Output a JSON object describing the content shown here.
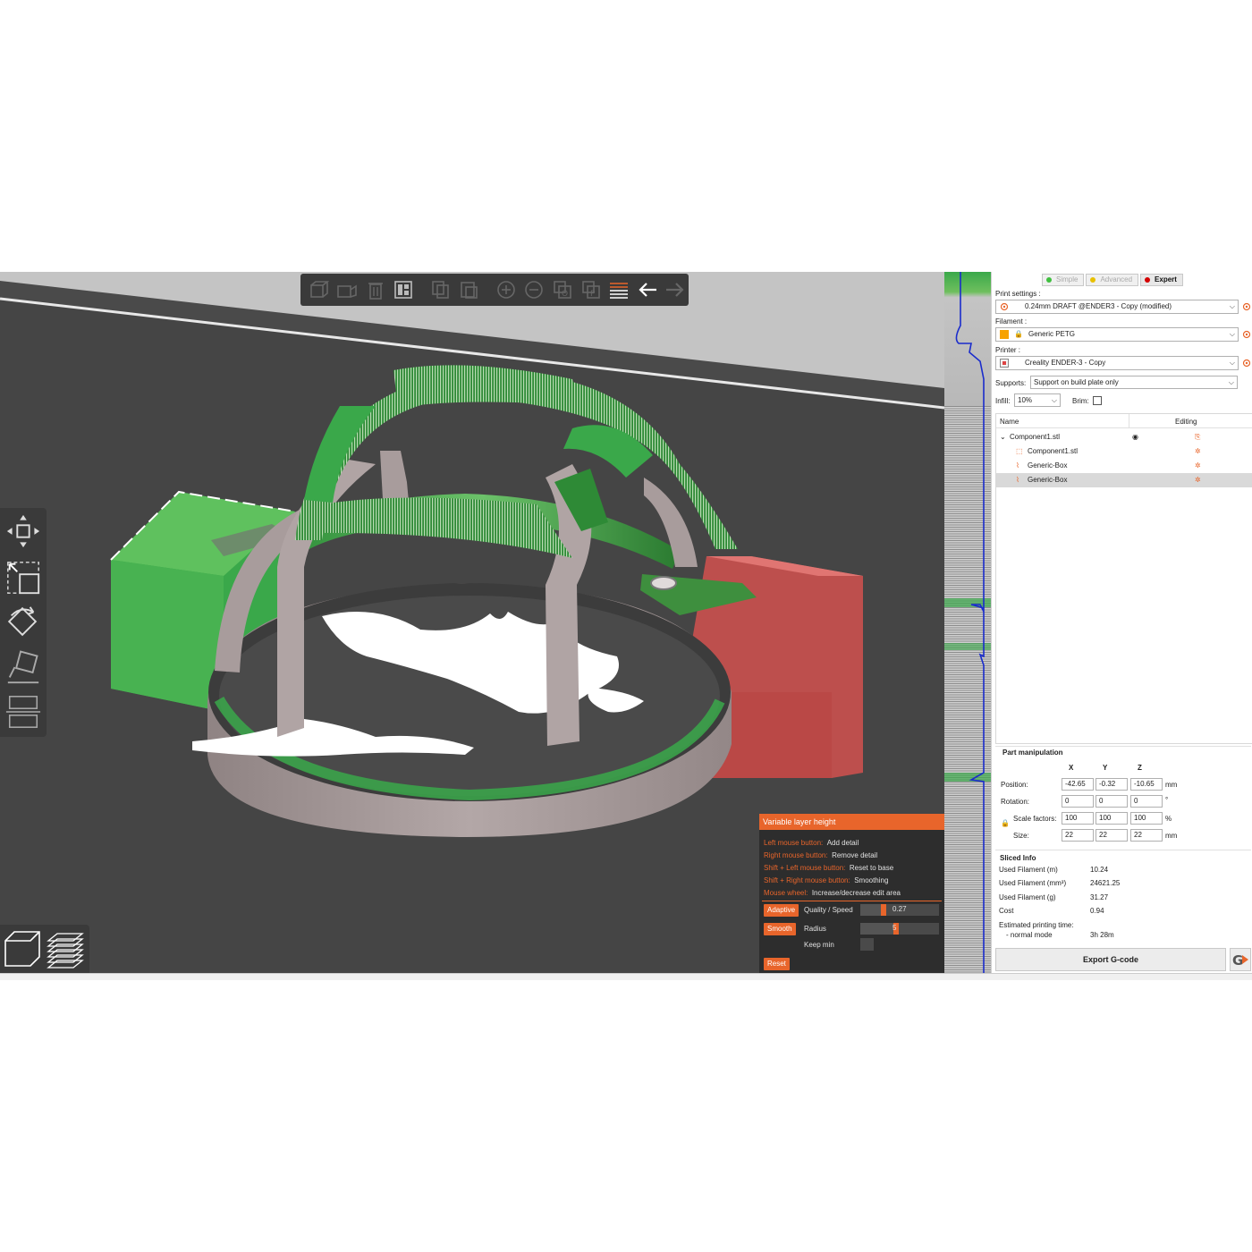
{
  "toolbar": {
    "icons": [
      "add-icon",
      "delete-icon",
      "delete-all-icon",
      "arrange-icon",
      "copy-icon",
      "paste-icon",
      "plus-icon",
      "minus-icon",
      "split-objects-icon",
      "split-parts-icon",
      "layers-editing-icon",
      "undo-icon",
      "redo-icon"
    ]
  },
  "left_tools": [
    "move-icon",
    "scale-icon",
    "rotate-icon",
    "place-on-face-icon",
    "cut-icon"
  ],
  "view_modes": [
    "3d-view-icon",
    "preview-icon"
  ],
  "vlh": {
    "title": "Variable layer height",
    "rows": [
      {
        "key": "Left mouse button:",
        "value": "Add detail"
      },
      {
        "key": "Right mouse button:",
        "value": "Remove detail"
      },
      {
        "key": "Shift + Left mouse button:",
        "value": "Reset to base"
      },
      {
        "key": "Shift + Right mouse button:",
        "value": "Smoothing"
      },
      {
        "key": "Mouse wheel:",
        "value": "Increase/decrease edit area"
      }
    ],
    "adaptive_label": "Adaptive",
    "quality_label": "Quality / Speed",
    "quality_value": "0.27",
    "quality_fraction": 0.3,
    "smooth_label": "Smooth",
    "radius_label": "Radius",
    "radius_value": "5",
    "radius_fraction": 0.45,
    "keep_min_label": "Keep min",
    "reset_label": "Reset"
  },
  "sidebar": {
    "modes": [
      {
        "label": "Simple",
        "color": "#3fbf3f",
        "active": false
      },
      {
        "label": "Advanced",
        "color": "#e8c000",
        "active": false
      },
      {
        "label": "Expert",
        "color": "#d40000",
        "active": true
      }
    ],
    "print_settings_label": "Print settings :",
    "print_settings_value": "0.24mm DRAFT @ENDER3 - Copy (modified)",
    "filament_label": "Filament :",
    "filament_value": "Generic PETG",
    "filament_color": "#f7a200",
    "printer_label": "Printer :",
    "printer_value": "Creality ENDER-3 - Copy",
    "supports_label": "Supports:",
    "supports_value": "Support on build plate only",
    "infill_label": "Infill:",
    "infill_value": "10%",
    "brim_label": "Brim:",
    "list_header_name": "Name",
    "list_header_editing": "Editing",
    "objects": [
      {
        "name": "Component1.stl",
        "level": 0
      },
      {
        "name": "Component1.stl",
        "level": 1
      },
      {
        "name": "Generic-Box",
        "level": 1
      },
      {
        "name": "Generic-Box",
        "level": 1,
        "selected": true
      }
    ],
    "part_manipulation": {
      "title": "Part manipulation",
      "axes": [
        "X",
        "Y",
        "Z"
      ],
      "position_label": "Position:",
      "position": [
        "-42.65",
        "-0.32",
        "-10.65"
      ],
      "position_unit": "mm",
      "rotation_label": "Rotation:",
      "rotation": [
        "0",
        "0",
        "0"
      ],
      "rotation_unit": "°",
      "scale_label": "Scale factors:",
      "scale": [
        "100",
        "100",
        "100"
      ],
      "scale_unit": "%",
      "size_label": "Size:",
      "size": [
        "22",
        "22",
        "22"
      ],
      "size_unit": "mm"
    },
    "sliced_info": {
      "title": "Sliced Info",
      "used_filament_m_label": "Used Filament (m)",
      "used_filament_m": "10.24",
      "used_filament_mm3_label": "Used Filament (mm³)",
      "used_filament_mm3": "24621.25",
      "used_filament_g_label": "Used Filament (g)",
      "used_filament_g": "31.27",
      "cost_label": "Cost",
      "cost": "0.94",
      "time_label": "Estimated printing time:",
      "normal_mode_label": "- normal mode",
      "normal_mode_value": "3h 28m"
    },
    "export_label": "Export G-code"
  },
  "colors": {
    "accent": "#e8652b",
    "viewport_bg": "#4a4a4a",
    "model_gray": "#a89c9c",
    "model_green": "#3aa84a",
    "model_red": "#d2514f"
  }
}
